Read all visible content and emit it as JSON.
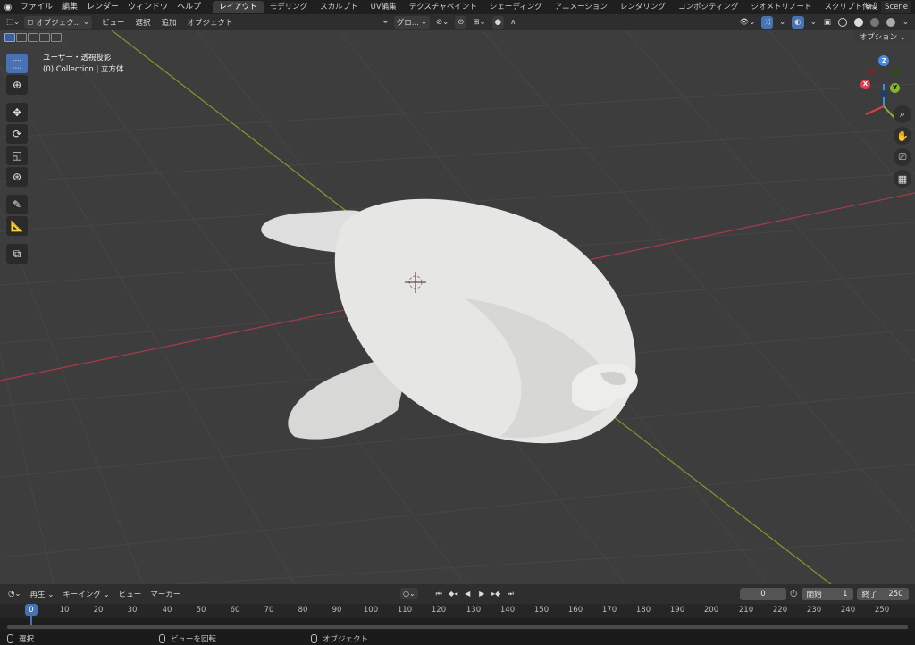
{
  "menubar": {
    "items": [
      "ファイル",
      "編集",
      "レンダー",
      "ウィンドウ",
      "ヘルプ"
    ],
    "workspaces": [
      "レイアウト",
      "モデリング",
      "スカルプト",
      "UV編集",
      "テクスチャペイント",
      "シェーディング",
      "アニメーション",
      "レンダリング",
      "コンポジティング",
      "ジオメトリノード",
      "スクリプト作成"
    ],
    "active_workspace": 0,
    "scene": "Scene"
  },
  "header": {
    "mode": "オブジェク...",
    "menus": [
      "ビュー",
      "選択",
      "追加",
      "オブジェクト"
    ],
    "transform_orientation": "グロ...",
    "options": "オプション"
  },
  "viewport": {
    "view_name": "ユーザー・透視投影",
    "collection_info": "(0) Collection | 立方体",
    "gizmo": {
      "x": "X",
      "y": "Y",
      "z": "Z"
    }
  },
  "timeline": {
    "menus": [
      "再生",
      "キーイング",
      "ビュー",
      "マーカー"
    ],
    "current_frame": "0",
    "start_label": "開始",
    "start_value": "1",
    "end_label": "終了",
    "end_value": "250",
    "playhead": "0",
    "ruler": [
      "10",
      "20",
      "30",
      "40",
      "50",
      "60",
      "70",
      "80",
      "90",
      "100",
      "110",
      "120",
      "130",
      "140",
      "150",
      "160",
      "170",
      "180",
      "190",
      "200",
      "210",
      "220",
      "230",
      "240",
      "250"
    ]
  },
  "statusbar": {
    "select": "選択",
    "rotate_view": "ビューを回転",
    "object": "オブジェクト"
  },
  "colors": {
    "accent": "#4772b3",
    "viewport_bg": "#3d3d3d",
    "axis_x": "#a83b4b",
    "axis_y": "#7d9a2c"
  }
}
